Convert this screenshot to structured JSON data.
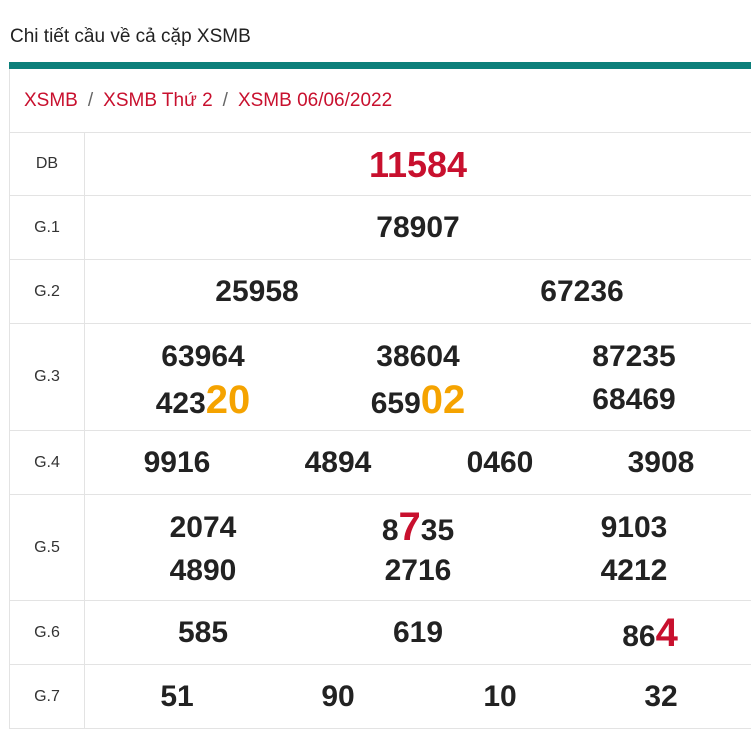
{
  "heading": "Chi tiết cầu về cả cặp XSMB",
  "breadcrumb": {
    "items": [
      "XSMB",
      "XSMB Thứ 2",
      "XSMB 06/06/2022"
    ],
    "separator": "/"
  },
  "colors": {
    "accent_bar": "#0c7f7a",
    "link": "#c8102e",
    "highlight_orange": "#f5a300",
    "highlight_red": "#c8102e"
  },
  "results": {
    "db": {
      "label": "DB",
      "value": "11584"
    },
    "g1": {
      "label": "G.1",
      "value": "78907"
    },
    "g2": {
      "label": "G.2",
      "values": [
        "25958",
        "67236"
      ]
    },
    "g3": {
      "label": "G.3",
      "values": [
        {
          "plain": "63964"
        },
        {
          "plain": "38604"
        },
        {
          "plain": "87235"
        },
        {
          "pre": "423",
          "hl": "20",
          "post": ""
        },
        {
          "pre": "659",
          "hl": "02",
          "post": ""
        },
        {
          "plain": "68469"
        }
      ]
    },
    "g4": {
      "label": "G.4",
      "values": [
        "9916",
        "4894",
        "0460",
        "3908"
      ]
    },
    "g5": {
      "label": "G.5",
      "values": [
        {
          "plain": "2074"
        },
        {
          "pre": "8",
          "hl": "7",
          "post": "35"
        },
        {
          "plain": "9103"
        },
        {
          "plain": "4890"
        },
        {
          "plain": "2716"
        },
        {
          "plain": "4212"
        }
      ]
    },
    "g6": {
      "label": "G.6",
      "values": [
        {
          "plain": "585"
        },
        {
          "plain": "619"
        },
        {
          "pre": "86",
          "hl": "4",
          "post": ""
        }
      ]
    },
    "g7": {
      "label": "G.7",
      "values": [
        "51",
        "90",
        "10",
        "32"
      ]
    }
  }
}
